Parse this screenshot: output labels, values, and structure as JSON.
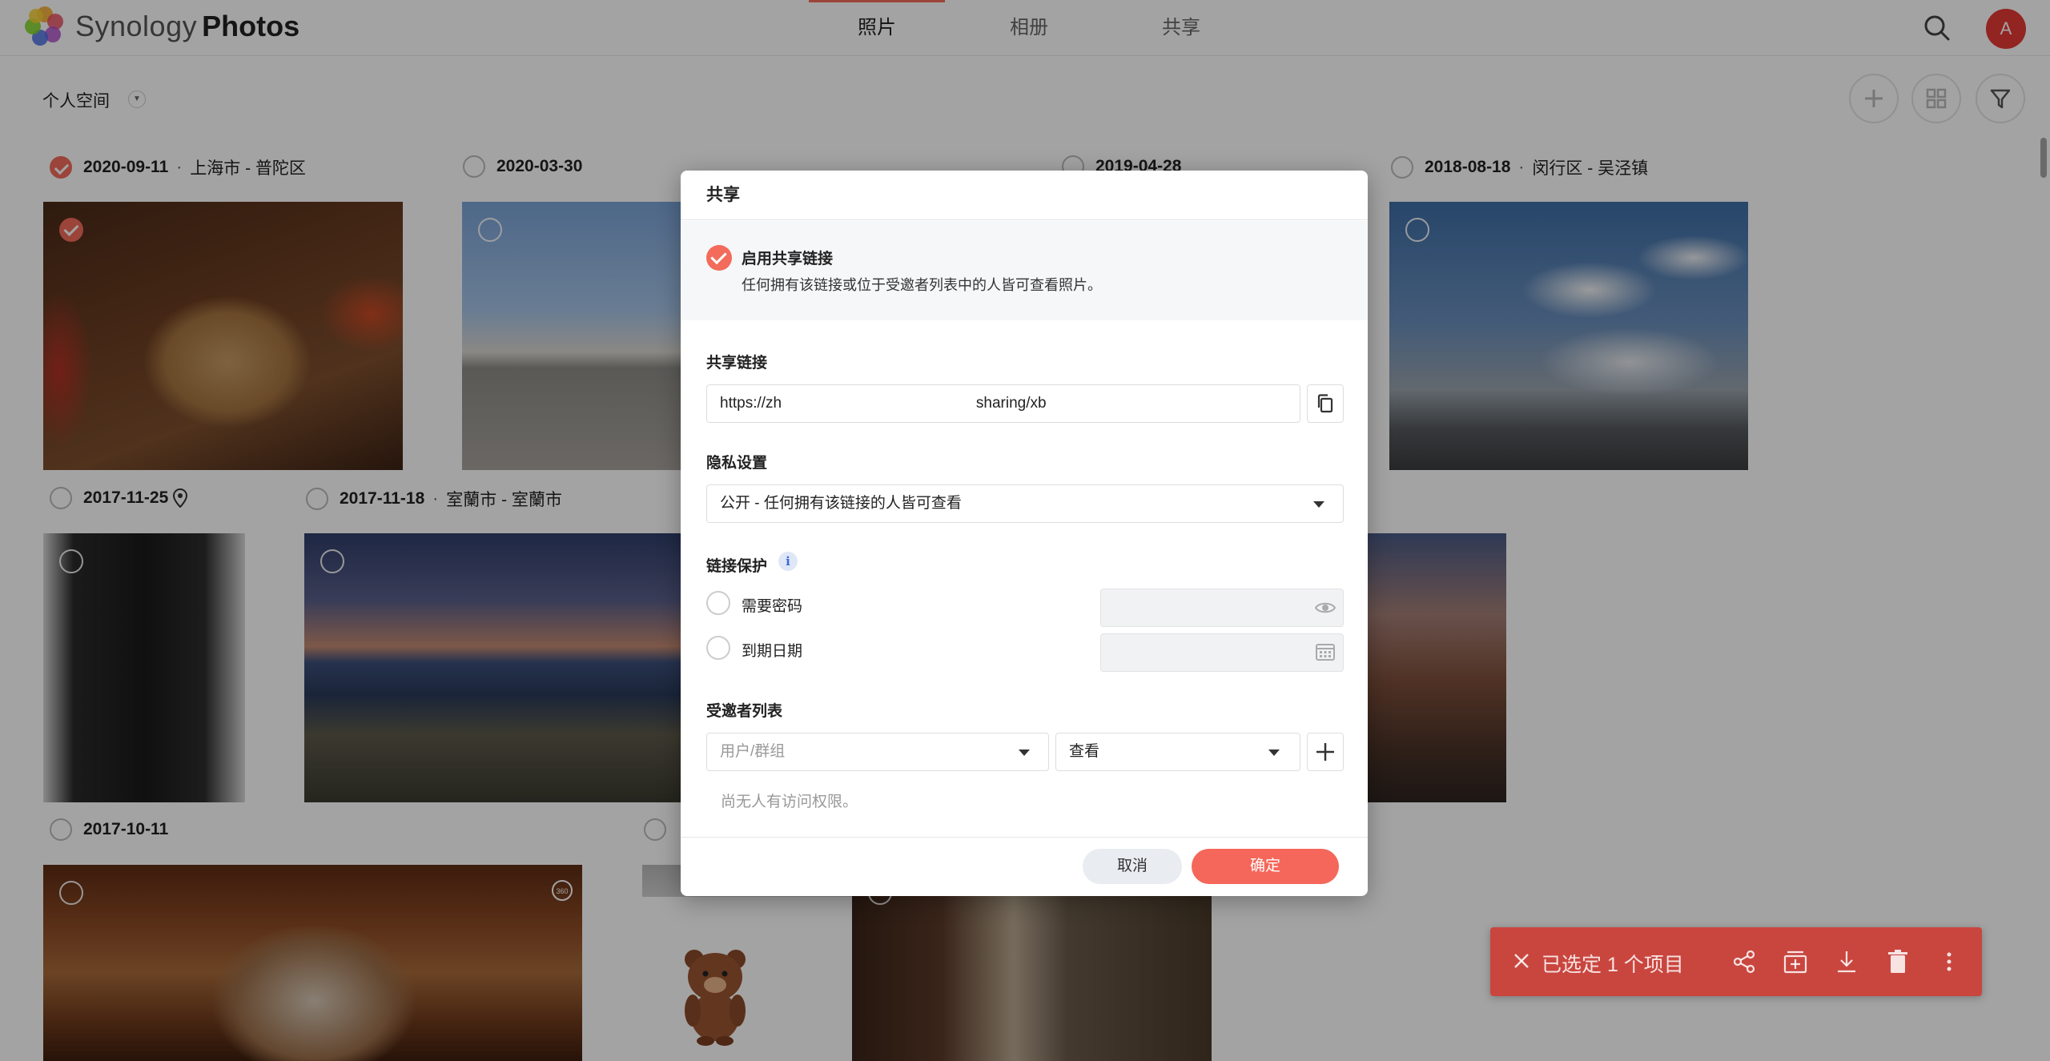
{
  "app": {
    "brand_part1": "Synology",
    "brand_part2": "Photos",
    "tabs": [
      {
        "label": "照片",
        "active": true
      },
      {
        "label": "相册",
        "active": false
      },
      {
        "label": "共享",
        "active": false
      }
    ],
    "avatar_letter": "A",
    "space_label": "个人空间",
    "accent_color": "#f26b5b"
  },
  "groups": [
    {
      "date": "2020-09-11",
      "location": "上海市 - 普陀区",
      "selected": true
    },
    {
      "date": "2020-03-30",
      "location": "",
      "selected": false
    },
    {
      "date": "2019-04-28",
      "location": "",
      "selected": false
    },
    {
      "date": "2018-08-18",
      "location": "闵行区 - 吴泾镇",
      "selected": false
    },
    {
      "date": "2017-11-25",
      "location": "",
      "selected": false
    },
    {
      "date": "2017-11-18",
      "location": "室蘭市 - 室蘭市",
      "selected": false
    },
    {
      "date": "2017-10-11",
      "location": "",
      "selected": false
    }
  ],
  "location_separator": "·",
  "dialog": {
    "title": "共享",
    "enable_title": "启用共享链接",
    "enable_desc": "任何拥有该链接或位于受邀者列表中的人皆可查看照片。",
    "link_label": "共享链接",
    "link_value": "https://zh                                              sharing/xb",
    "privacy_label": "隐私设置",
    "privacy_value": "公开 - 任何拥有该链接的人皆可查看",
    "protection_label": "链接保护",
    "info_glyph": "i",
    "password_label": "需要密码",
    "expiry_label": "到期日期",
    "invitee_label": "受邀者列表",
    "user_placeholder": "用户/群组",
    "permission_value": "查看",
    "no_access_text": "尚无人有访问权限。",
    "cancel_label": "取消",
    "ok_label": "确定"
  },
  "selection_bar": {
    "text": "已选定 1 个项目",
    "icons": [
      "share-icon",
      "add-to-album-icon",
      "download-icon",
      "delete-icon",
      "more-icon"
    ],
    "color": "#c9463f"
  }
}
